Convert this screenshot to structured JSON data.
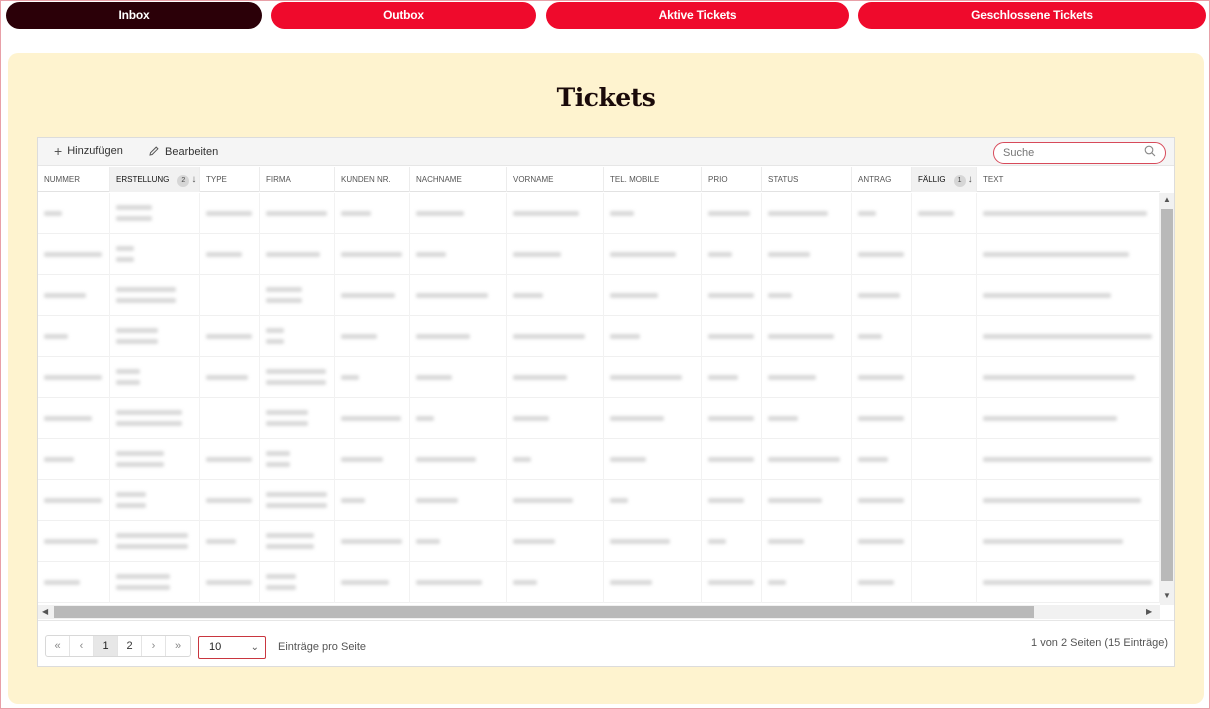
{
  "tabs": [
    {
      "label": "Inbox",
      "active": true
    },
    {
      "label": "Outbox",
      "active": false
    },
    {
      "label": "Aktive Tickets",
      "active": false
    },
    {
      "label": "Geschlossene Tickets",
      "active": false
    }
  ],
  "page": {
    "title": "Tickets"
  },
  "toolbar": {
    "add_label": "Hinzufügen",
    "add_icon": "plus-icon",
    "edit_label": "Bearbeiten",
    "edit_icon": "pencil-icon",
    "search_placeholder": "Suche",
    "search_icon": "search-icon"
  },
  "columns": [
    {
      "label": "NUMMER"
    },
    {
      "label": "ERSTELLUNG",
      "sort_index": "2",
      "sort_dir": "desc"
    },
    {
      "label": "TYPE"
    },
    {
      "label": "FIRMA"
    },
    {
      "label": "KUNDEN NR."
    },
    {
      "label": "NACHNAME"
    },
    {
      "label": "VORNAME"
    },
    {
      "label": "TEL. MOBILE"
    },
    {
      "label": "PRIO"
    },
    {
      "label": "STATUS"
    },
    {
      "label": "ANTRAG"
    },
    {
      "label": "FÄLLIG",
      "sort_index": "1",
      "sort_dir": "desc"
    },
    {
      "label": "TEXT"
    }
  ],
  "rows_note_visible": "cell contents are blurred/unreadable in the screenshot",
  "pager": {
    "first": "«",
    "prev": "‹",
    "pages": [
      "1",
      "2"
    ],
    "current_page": "1",
    "next": "›",
    "last": "»",
    "page_size": "10",
    "per_page_label": "Einträge pro Seite",
    "info": "1 von 2 Seiten (15 Einträge)"
  },
  "colors": {
    "tab_red": "#ef0a2c",
    "tab_active": "#2b0008",
    "panel_bg": "#fef3cf",
    "search_border": "#d74a5a"
  }
}
